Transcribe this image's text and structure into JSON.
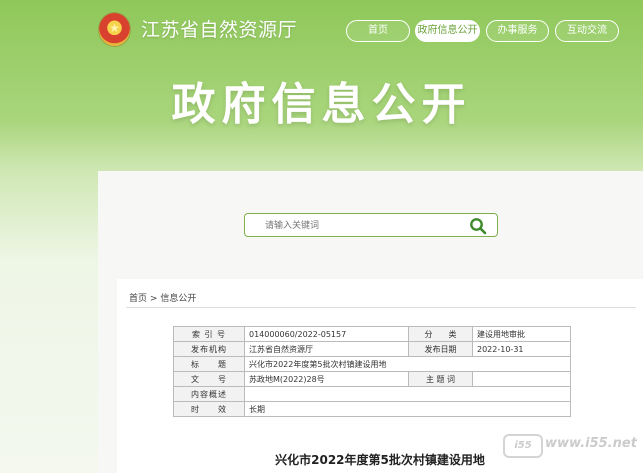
{
  "header": {
    "site_name": "江苏省自然资源厅",
    "nav": [
      {
        "label": "首页"
      },
      {
        "label": "政府信息公开"
      },
      {
        "label": "办事服务"
      },
      {
        "label": "互动交流"
      }
    ]
  },
  "banner": {
    "title": "政府信息公开"
  },
  "search": {
    "placeholder": "请输入关键词"
  },
  "breadcrumb": {
    "home": "首页",
    "sep": ">",
    "current": "信息公开"
  },
  "meta": {
    "index_label": "索 引 号",
    "index_value": "014000060/2022-05157",
    "category_label": "分　　类",
    "category_value": "建设用地审批",
    "publisher_label": "发布机构",
    "publisher_value": "江苏省自然资源厅",
    "date_label": "发布日期",
    "date_value": "2022-10-31",
    "title_label": "标　　题",
    "title_value": "兴化市2022年度第5批次村镇建设用地",
    "docno_label": "文　　号",
    "docno_value": "苏政地M(2022)28号",
    "subject_label": "主 题 词",
    "subject_value": "",
    "summary_label": "内容概述",
    "summary_value": "",
    "validity_label": "时　　效",
    "validity_value": "长期"
  },
  "document": {
    "title": "兴化市2022年度第5批次村镇建设用地"
  },
  "watermark": {
    "text": "www.i55.net"
  }
}
